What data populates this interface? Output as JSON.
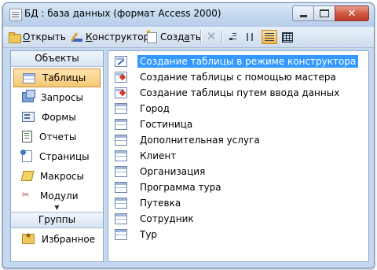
{
  "window": {
    "title": "БД : база данных (формат Access 2000)"
  },
  "toolbar": {
    "open_pre": "",
    "open_u": "О",
    "open_rest": "ткрыть",
    "design_pre": "",
    "design_u": "К",
    "design_rest": "онструктор",
    "create_pre": "Созд",
    "create_u": "а",
    "create_rest": "ть"
  },
  "objects_panel": {
    "header": "Объекты",
    "items": [
      {
        "label": "Таблицы",
        "icon": "table-icon",
        "selected": true
      },
      {
        "label": "Запросы",
        "icon": "query-icon"
      },
      {
        "label": "Формы",
        "icon": "form-icon"
      },
      {
        "label": "Отчеты",
        "icon": "report-icon"
      },
      {
        "label": "Страницы",
        "icon": "page-icon"
      },
      {
        "label": "Макросы",
        "icon": "macro-icon"
      },
      {
        "label": "Модули",
        "icon": "module-icon"
      }
    ],
    "groups_header": "Группы",
    "groups": [
      {
        "label": "Избранное",
        "icon": "favorites-icon"
      }
    ]
  },
  "list": {
    "items": [
      {
        "label": "Создание таблицы в режиме конструктора",
        "icon": "design-table-icon",
        "selected": true
      },
      {
        "label": "Создание таблицы с помощью мастера",
        "icon": "wizard-icon"
      },
      {
        "label": "Создание таблицы путем ввода данных",
        "icon": "wizard-icon"
      },
      {
        "label": "Город",
        "icon": "table-icon"
      },
      {
        "label": "Гостиница",
        "icon": "table-icon"
      },
      {
        "label": "Дополнительная услуга",
        "icon": "table-icon"
      },
      {
        "label": "Клиент",
        "icon": "table-icon"
      },
      {
        "label": "Организация",
        "icon": "table-icon"
      },
      {
        "label": "Программа тура",
        "icon": "table-icon"
      },
      {
        "label": "Путевка",
        "icon": "table-icon"
      },
      {
        "label": "Сотрудник",
        "icon": "table-icon"
      },
      {
        "label": "Тур",
        "icon": "table-icon"
      }
    ]
  },
  "colors": {
    "selection": "#3399ff",
    "object_selected": "#f8c874",
    "window_frame": "#c4d8ef"
  }
}
